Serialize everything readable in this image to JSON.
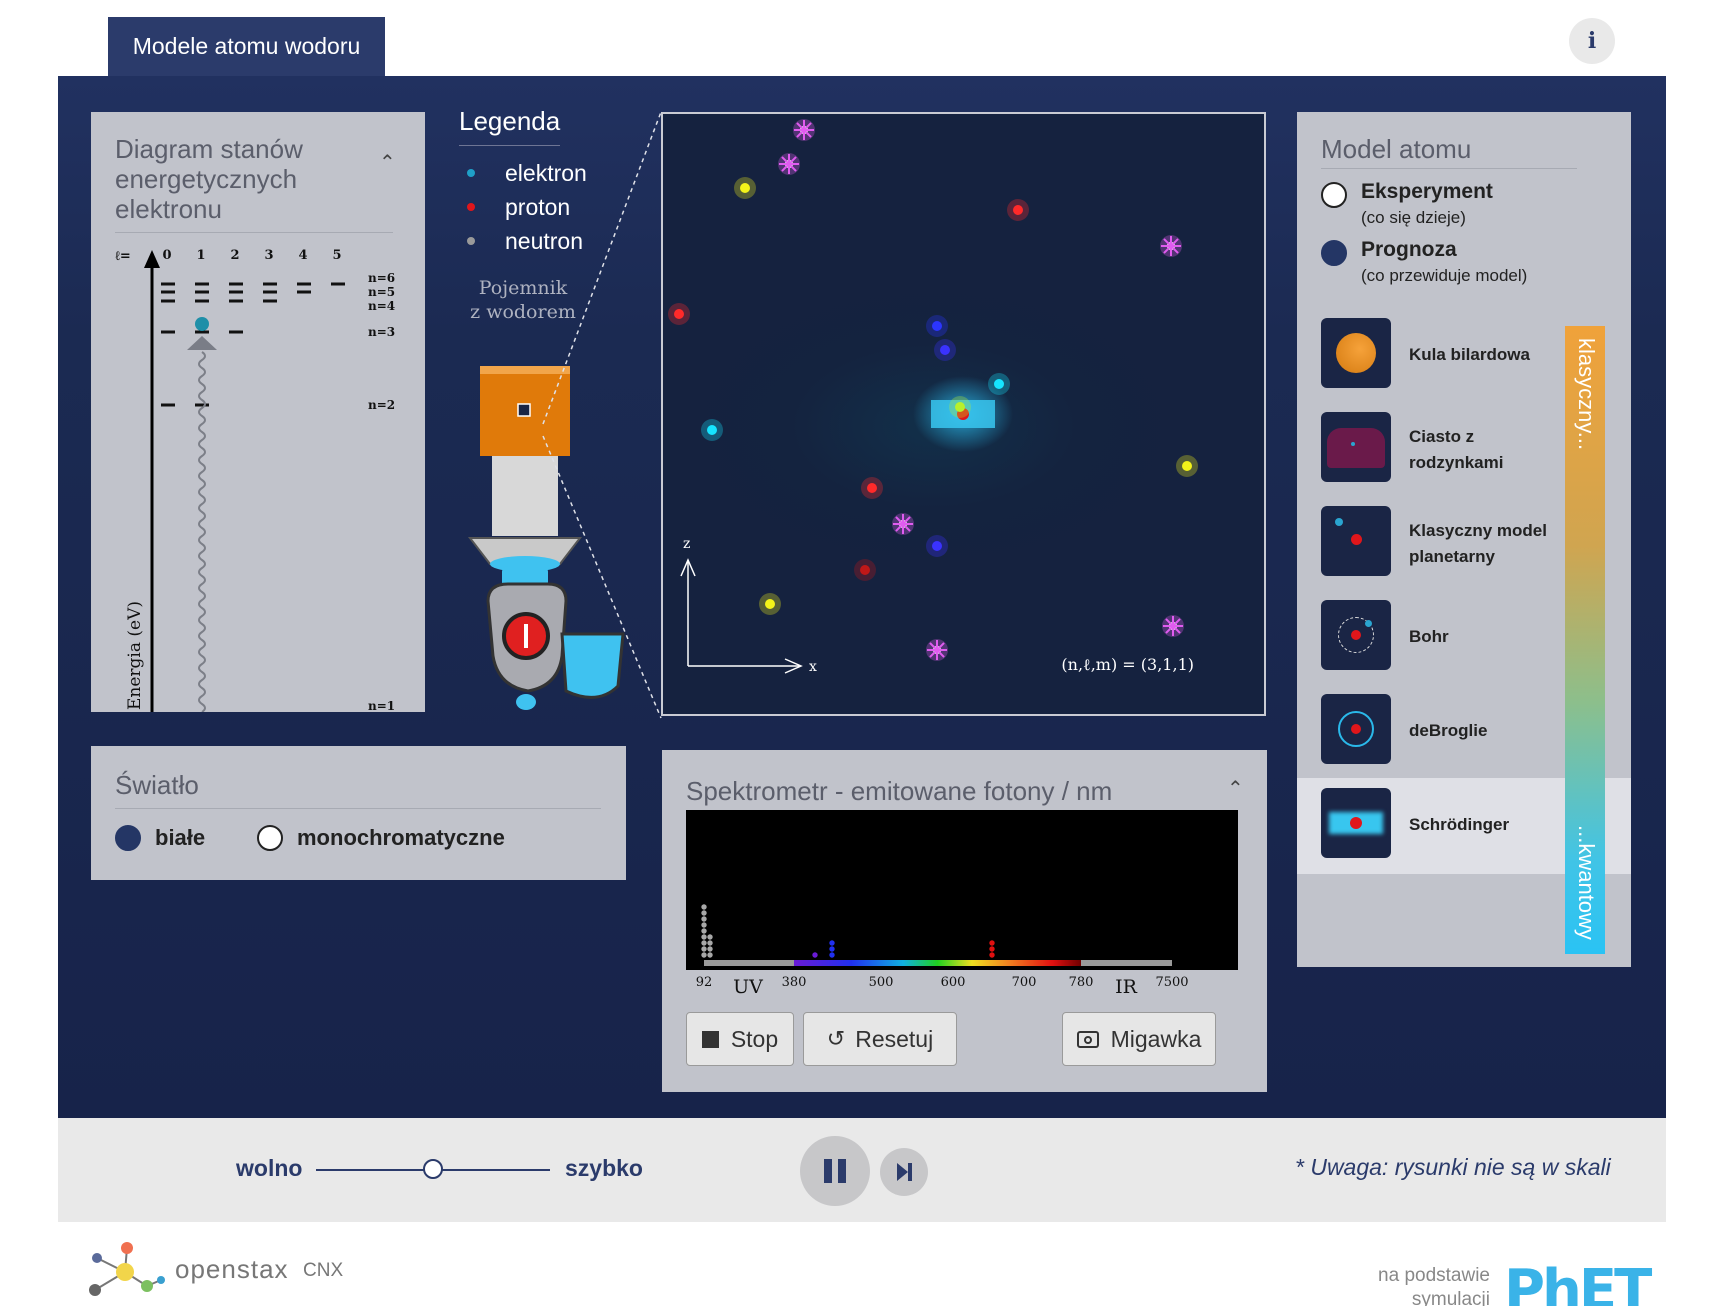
{
  "header": {
    "tab_label": "Modele atomu wodoru",
    "info_icon": "i"
  },
  "energy_diagram": {
    "title": "Diagram stanów energetycznych elektronu",
    "l_label": "ℓ=",
    "l_values": [
      "0",
      "1",
      "2",
      "3",
      "4",
      "5"
    ],
    "levels": [
      "n=6",
      "n=5",
      "n=4",
      "n=3",
      "n=2",
      "n=1"
    ],
    "axis_label": "Energia (eV)"
  },
  "legend": {
    "title": "Legenda",
    "items": [
      {
        "label": "elektron",
        "color": "#1fa0c8"
      },
      {
        "label": "proton",
        "color": "#e0161b"
      },
      {
        "label": "neutron",
        "color": "#9a9a9a"
      }
    ]
  },
  "container": {
    "label_line1": "Pojemnik",
    "label_line2": "z wodorem"
  },
  "view": {
    "axis_z": "z",
    "axis_x": "x",
    "state": "(n,ℓ,m) = (3,1,1)"
  },
  "light": {
    "title": "Światło",
    "options": [
      "białe",
      "monochromatyczne"
    ],
    "selected": "białe"
  },
  "spectrometer": {
    "title": "Spektrometr - emitowane fotony / nm",
    "ticks": [
      "92",
      "380",
      "500",
      "600",
      "700",
      "780",
      "7500"
    ],
    "region_uv": "UV",
    "region_ir": "IR",
    "buttons": {
      "stop": "Stop",
      "reset": "Resetuj",
      "snapshot": "Migawka"
    }
  },
  "model": {
    "title": "Model atomu",
    "modes": [
      {
        "label": "Eksperyment",
        "sub": "(co się dzieje)",
        "selected": false
      },
      {
        "label": "Prognoza",
        "sub": "(co przewiduje model)",
        "selected": true
      }
    ],
    "models": [
      "Kula bilardowa",
      "Ciasto z rodzynkami",
      "Klasyczny model planetarny",
      "Bohr",
      "deBroglie",
      "Schrödinger"
    ],
    "selected_model": "Schrödinger",
    "scale_top": "klasyczny...",
    "scale_bottom": "...kwantowy"
  },
  "controls": {
    "slow": "wolno",
    "fast": "szybko",
    "speed_level": 0.5,
    "note": "* Uwaga: rysunki nie są w skali"
  },
  "footer": {
    "openstax": "openstax",
    "cnx": "CNX",
    "based_on_1": "na podstawie",
    "based_on_2": "symulacji",
    "phet": "PhET"
  }
}
